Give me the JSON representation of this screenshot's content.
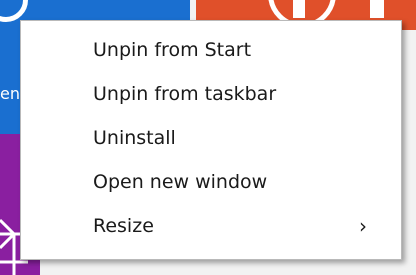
{
  "menu": {
    "items": [
      {
        "label": "Unpin from Start"
      },
      {
        "label": "Unpin from taskbar"
      },
      {
        "label": "Uninstall"
      },
      {
        "label": "Open new window"
      },
      {
        "label": "Resize",
        "arrow": "›"
      }
    ]
  },
  "background": {
    "tile_caption": "en"
  },
  "colors": {
    "tile_blue": "#1a6fd0",
    "tile_orange": "#e0502a",
    "tile_purple": "#8a1fa0",
    "menu_bg": "#ffffff"
  },
  "icons": {
    "tile_glyph": "app-tile-icon",
    "submenu": "chevron-right-icon",
    "web": "web-tile-icon"
  }
}
